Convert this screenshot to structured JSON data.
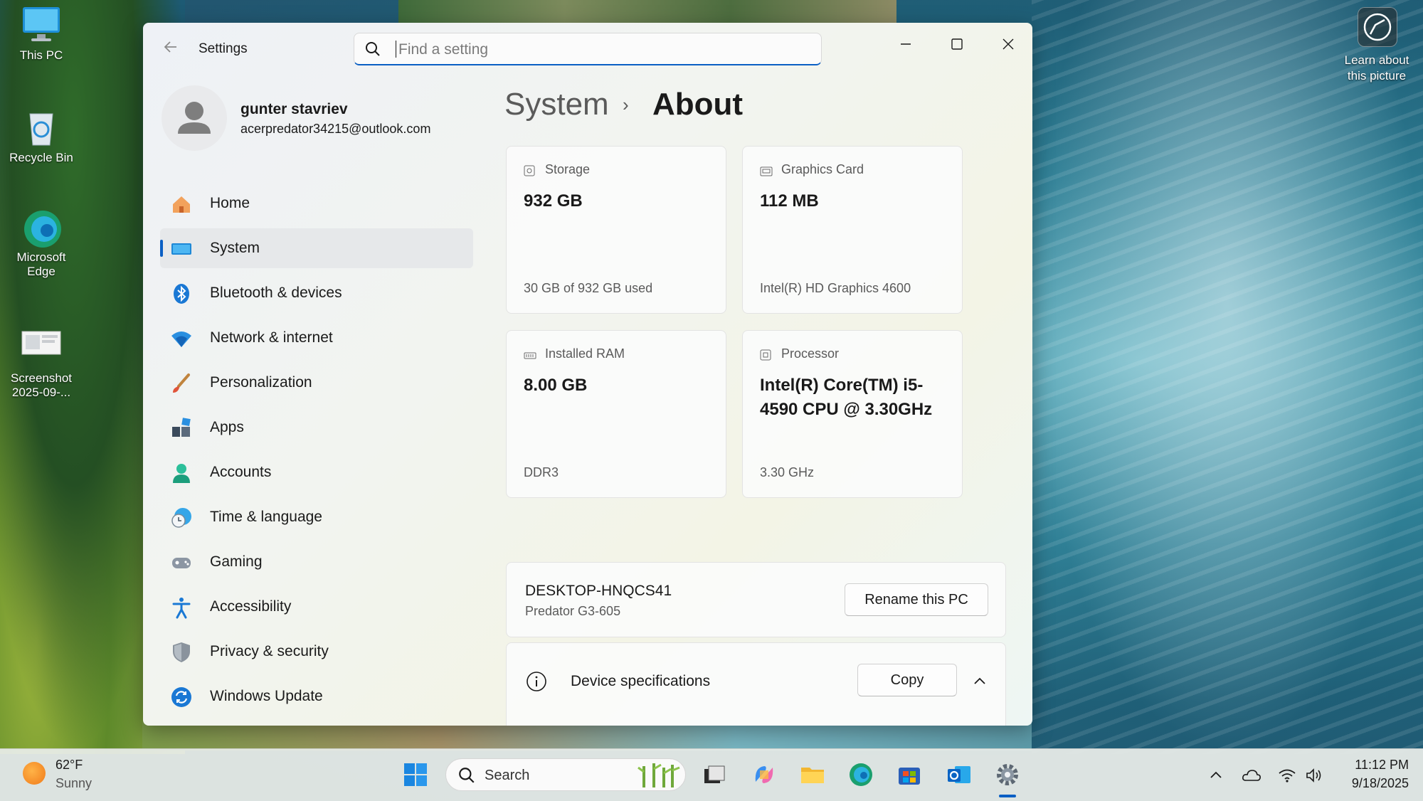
{
  "desktop": {
    "icons": [
      {
        "label": "This PC"
      },
      {
        "label": "Recycle Bin"
      },
      {
        "label": "Microsoft Edge"
      },
      {
        "label": "Screenshot 2025-09-..."
      }
    ],
    "learn_label": "Learn about this picture"
  },
  "window": {
    "title": "Settings",
    "search": {
      "placeholder": "Find a setting"
    },
    "controls": {
      "minimize": "minimize-icon",
      "maximize": "maximize-icon",
      "close": "close-icon"
    }
  },
  "profile": {
    "name": "gunter stavriev",
    "email": "acerpredator34215@outlook.com"
  },
  "nav": {
    "items": [
      {
        "label": "Home",
        "icon": "home-icon"
      },
      {
        "label": "System",
        "icon": "system-icon",
        "active": true
      },
      {
        "label": "Bluetooth & devices",
        "icon": "bluetooth-icon"
      },
      {
        "label": "Network & internet",
        "icon": "wifi-icon"
      },
      {
        "label": "Personalization",
        "icon": "brush-icon"
      },
      {
        "label": "Apps",
        "icon": "apps-icon"
      },
      {
        "label": "Accounts",
        "icon": "accounts-icon"
      },
      {
        "label": "Time & language",
        "icon": "clock-globe-icon"
      },
      {
        "label": "Gaming",
        "icon": "gamepad-icon"
      },
      {
        "label": "Accessibility",
        "icon": "accessibility-icon"
      },
      {
        "label": "Privacy & security",
        "icon": "shield-icon"
      },
      {
        "label": "Windows Update",
        "icon": "update-icon"
      }
    ]
  },
  "breadcrumb": {
    "parent": "System",
    "separator": "›",
    "current": "About"
  },
  "cards": [
    {
      "title": "Storage",
      "value": "932 GB",
      "detail": "30 GB of 932 GB used",
      "icon": "storage-icon"
    },
    {
      "title": "Graphics Card",
      "value": "112 MB",
      "detail": "Intel(R) HD Graphics 4600",
      "icon": "graphics-card-icon"
    },
    {
      "title": "Installed RAM",
      "value": "8.00 GB",
      "detail": "DDR3",
      "icon": "ram-icon"
    },
    {
      "title": "Processor",
      "value": "Intel(R) Core(TM) i5-4590 CPU @ 3.30GHz",
      "detail": "3.30 GHz",
      "icon": "processor-icon"
    }
  ],
  "pc": {
    "name": "DESKTOP-HNQCS41",
    "model": "Predator G3-605",
    "rename_label": "Rename this PC"
  },
  "specs": {
    "title": "Device specifications",
    "copy_label": "Copy"
  },
  "taskbar": {
    "weather": {
      "temp": "62°F",
      "condition": "Sunny"
    },
    "search_label": "Search",
    "apps": [
      "start-icon",
      "task-view-icon",
      "copilot-icon",
      "file-explorer-icon",
      "edge-icon",
      "store-icon",
      "outlook-icon",
      "settings-icon"
    ],
    "clock": {
      "time": "11:12 PM",
      "date": "9/18/2025"
    }
  },
  "colors": {
    "accent": "#0a5fc4",
    "text": "#1a1a1a",
    "muted": "#5a5a5a"
  }
}
